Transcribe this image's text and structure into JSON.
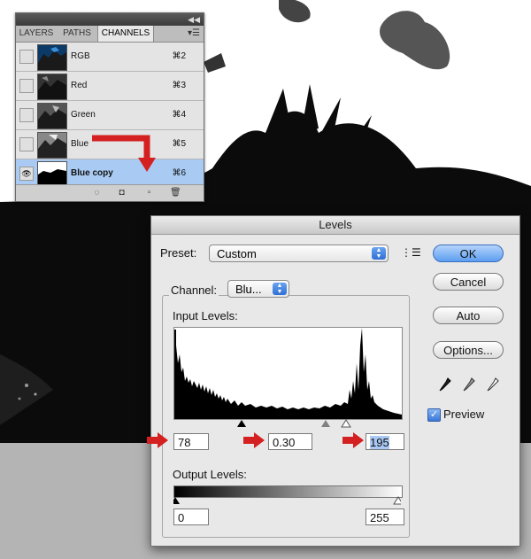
{
  "channels_panel": {
    "tabs": [
      "LAYERS",
      "PATHS",
      "CHANNELS"
    ],
    "active_tab": "CHANNELS",
    "channels": [
      {
        "name": "RGB",
        "shortcut": "⌘2",
        "visible": false,
        "selected": false
      },
      {
        "name": "Red",
        "shortcut": "⌘3",
        "visible": false,
        "selected": false
      },
      {
        "name": "Green",
        "shortcut": "⌘4",
        "visible": false,
        "selected": false
      },
      {
        "name": "Blue",
        "shortcut": "⌘5",
        "visible": false,
        "selected": false
      },
      {
        "name": "Blue copy",
        "shortcut": "⌘6",
        "visible": true,
        "selected": true
      }
    ],
    "bottom_icons": [
      "load-selection-icon",
      "save-selection-icon",
      "new-channel-icon",
      "trash-icon"
    ]
  },
  "levels": {
    "title": "Levels",
    "preset_label": "Preset:",
    "preset_value": "Custom",
    "channel_label": "Channel:",
    "channel_value": "Blu...",
    "input_levels_label": "Input Levels:",
    "input_black": "78",
    "input_gamma": "0.30",
    "input_white": "195",
    "output_levels_label": "Output Levels:",
    "output_black": "0",
    "output_white": "255",
    "buttons": {
      "ok": "OK",
      "cancel": "Cancel",
      "auto": "Auto",
      "options": "Options..."
    },
    "preview_label": "Preview",
    "preview_checked": true
  },
  "colors": {
    "accent": "#5c9df0",
    "arrow": "#d42020",
    "selected_row": "#a9cbf3"
  }
}
